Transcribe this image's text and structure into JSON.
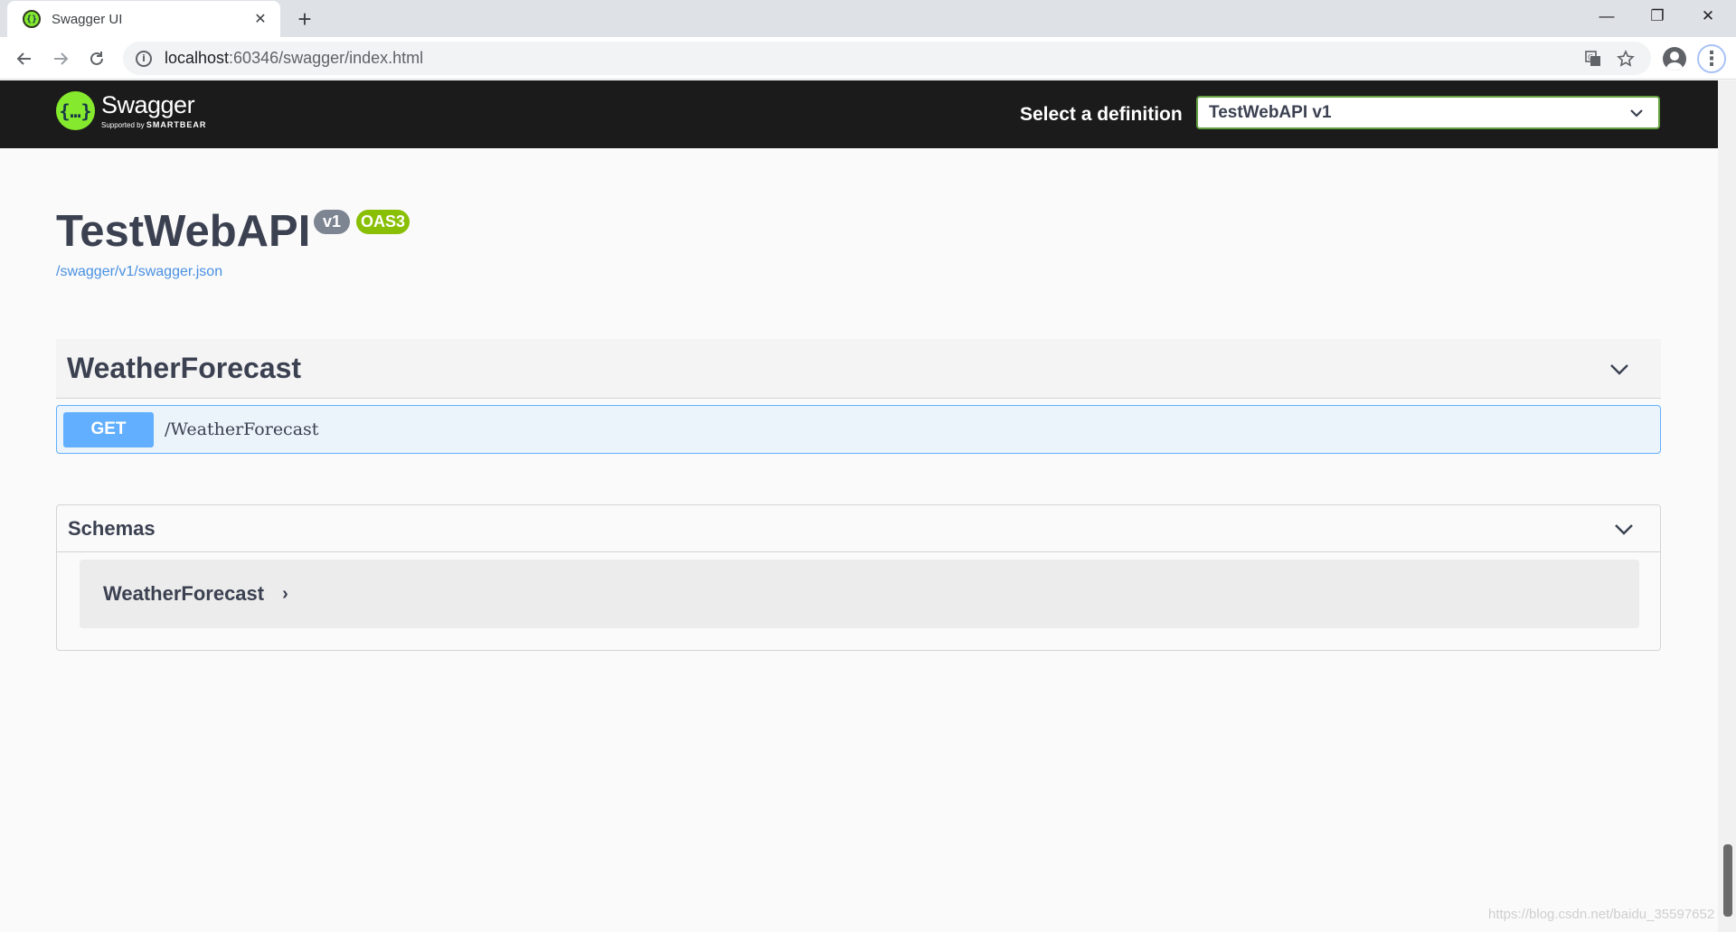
{
  "browser": {
    "tab_title": "Swagger UI",
    "tab_close": "✕",
    "new_tab": "+",
    "window": {
      "minimize": "—",
      "restore": "❐",
      "close": "✕"
    },
    "url_host": "localhost",
    "url_path": ":60346/swagger/index.html"
  },
  "topbar": {
    "logo_name": "Swagger",
    "logo_sub_prefix": "Supported by",
    "logo_sub_brand": "SMARTBEAR",
    "select_label": "Select a definition",
    "selected_definition": "TestWebAPI v1"
  },
  "info": {
    "title": "TestWebAPI",
    "version_badge": "v1",
    "spec_badge": "OAS3",
    "spec_link": "/swagger/v1/swagger.json"
  },
  "tags": [
    {
      "name": "WeatherForecast",
      "operations": [
        {
          "method": "GET",
          "path": "/WeatherForecast"
        }
      ]
    }
  ],
  "schemas": {
    "title": "Schemas",
    "models": [
      {
        "name": "WeatherForecast",
        "toggle": "›"
      }
    ]
  },
  "watermark": "https://blog.csdn.net/baidu_35597652",
  "colors": {
    "get": "#61affe",
    "swagger_green": "#85ea2d",
    "badge_oas": "#89bf04",
    "badge_version": "#7d8492",
    "link": "#4990e2"
  }
}
